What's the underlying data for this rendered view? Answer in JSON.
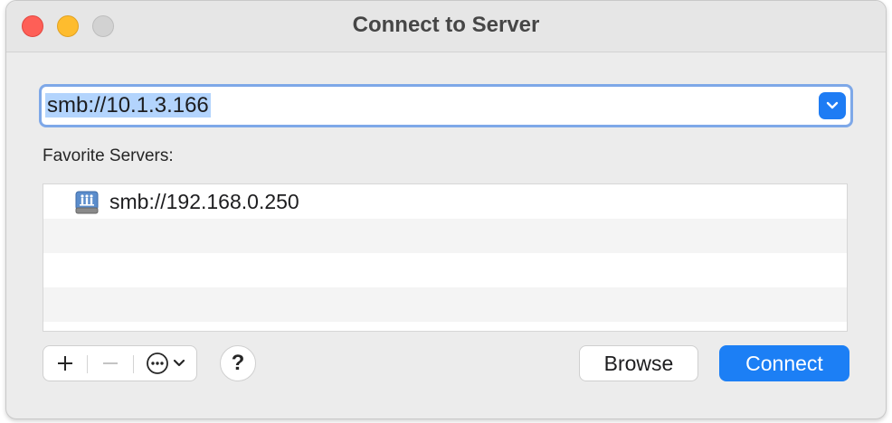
{
  "window": {
    "title": "Connect to Server"
  },
  "address": {
    "value": "smb://10.1.3.166",
    "dropdown_icon": "chevron-down-icon"
  },
  "favorites": {
    "label": "Favorite Servers:",
    "items": [
      {
        "label": "smb://192.168.0.250",
        "icon": "network-server-icon"
      }
    ]
  },
  "toolbar": {
    "add_icon": "plus-icon",
    "remove_icon": "minus-icon",
    "more_icon": "ellipsis-circle-icon",
    "help_label": "?",
    "browse_label": "Browse",
    "connect_label": "Connect"
  },
  "colors": {
    "accent": "#1c7ff5",
    "selection": "#b3d4fd",
    "close": "#fe5f57",
    "minimize": "#febc2e",
    "zoom_disabled": "#d2d2d2"
  }
}
